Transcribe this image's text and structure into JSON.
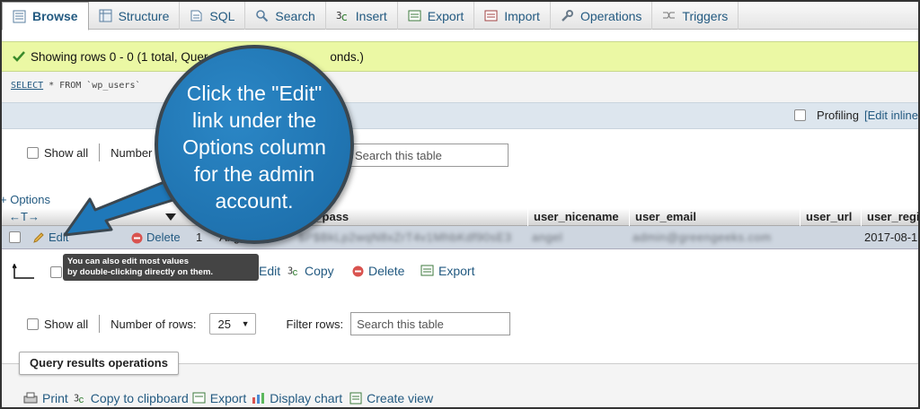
{
  "tabs": [
    {
      "label": "Browse",
      "icon": "browse-icon",
      "active": true
    },
    {
      "label": "Structure",
      "icon": "structure-icon"
    },
    {
      "label": "SQL",
      "icon": "sql-icon"
    },
    {
      "label": "Search",
      "icon": "search-icon"
    },
    {
      "label": "Insert",
      "icon": "insert-icon"
    },
    {
      "label": "Export",
      "icon": "export-icon"
    },
    {
      "label": "Import",
      "icon": "import-icon"
    },
    {
      "label": "Operations",
      "icon": "wrench-icon"
    },
    {
      "label": "Triggers",
      "icon": "triggers-icon"
    }
  ],
  "success": {
    "message": "Showing rows 0 - 0 (1 total, Quer",
    "tail": "onds.)"
  },
  "sql": {
    "keyword": "SELECT",
    "rest": " * FROM `wp_users`"
  },
  "profiling": {
    "label": "Profiling",
    "link": "[Edit inline"
  },
  "nav": {
    "show_all": "Show all",
    "number_rows_label": "Number of rows:",
    "number_rows_label_short": "Number",
    "rows_value": "25",
    "filter_label": "Filter rows:",
    "search_placeholder": "Search this table"
  },
  "options_link": "+ Options",
  "sort_arrows": "←T→",
  "columns": [
    "er_pass",
    "user_nicename",
    "user_email",
    "user_url",
    "user_regi"
  ],
  "row": {
    "edit": "Edit",
    "delete": "Delete",
    "id": "1",
    "login": "Angel",
    "pass": "$P$BkLp2wqN8xZrT4v1MhbKdf90sE3",
    "nicename": "angel",
    "email": "admin@greengeeks.com",
    "registered": "2017-08-1"
  },
  "tooltip": {
    "line1": "You can also edit most values",
    "line2": "by double-clicking directly on them."
  },
  "bulk": {
    "edit": "Edit",
    "copy": "Copy",
    "delete": "Delete",
    "export": "Export"
  },
  "query_results": "Query results operations",
  "bottom_links": [
    "Print",
    "Copy to clipboard",
    "Export",
    "Display chart",
    "Create view"
  ],
  "callout": "Click the \"Edit\" link under the Options column for the admin account.",
  "colors": {
    "link": "#235a81",
    "success_bg": "#ebf8a4",
    "row_bg": "#ced6e0",
    "callout": "#1f78b9"
  }
}
